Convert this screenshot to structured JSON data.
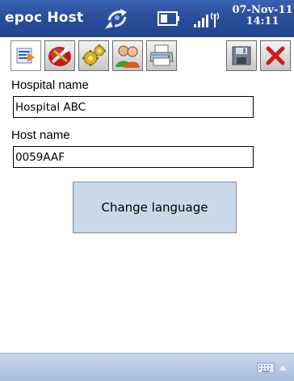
{
  "titlebar": {
    "title": "epoc Host",
    "date": "07-Nov-11",
    "time": "14:11",
    "icons": [
      "sync-icon",
      "battery-icon",
      "signal-icon"
    ]
  },
  "toolbar": {
    "buttons": [
      {
        "name": "host-info-tab",
        "icon": "host-info-icon",
        "selected": true
      },
      {
        "name": "tools-tab",
        "icon": "tools-icon",
        "selected": false
      },
      {
        "name": "settings-tab",
        "icon": "gear-icon",
        "selected": false
      },
      {
        "name": "users-tab",
        "icon": "users-icon",
        "selected": false
      },
      {
        "name": "printer-tab",
        "icon": "printer-icon",
        "selected": false
      },
      {
        "name": "save-button",
        "icon": "save-icon",
        "selected": false
      },
      {
        "name": "close-button",
        "icon": "close-icon",
        "selected": false
      }
    ]
  },
  "form": {
    "hospital_label": "Hospital name",
    "hospital_value": "Hospital ABC",
    "host_label": "Host name",
    "host_value": "0059AAF",
    "change_language_label": "Change language"
  },
  "softbar": {
    "icons": [
      "keyboard-icon",
      "arrow-up-icon"
    ]
  },
  "colors": {
    "titlebar": "#2a4e9a",
    "button_face": "#c9d9ea",
    "softbar": "#b8cbe6",
    "close_red": "#d01a1a"
  }
}
